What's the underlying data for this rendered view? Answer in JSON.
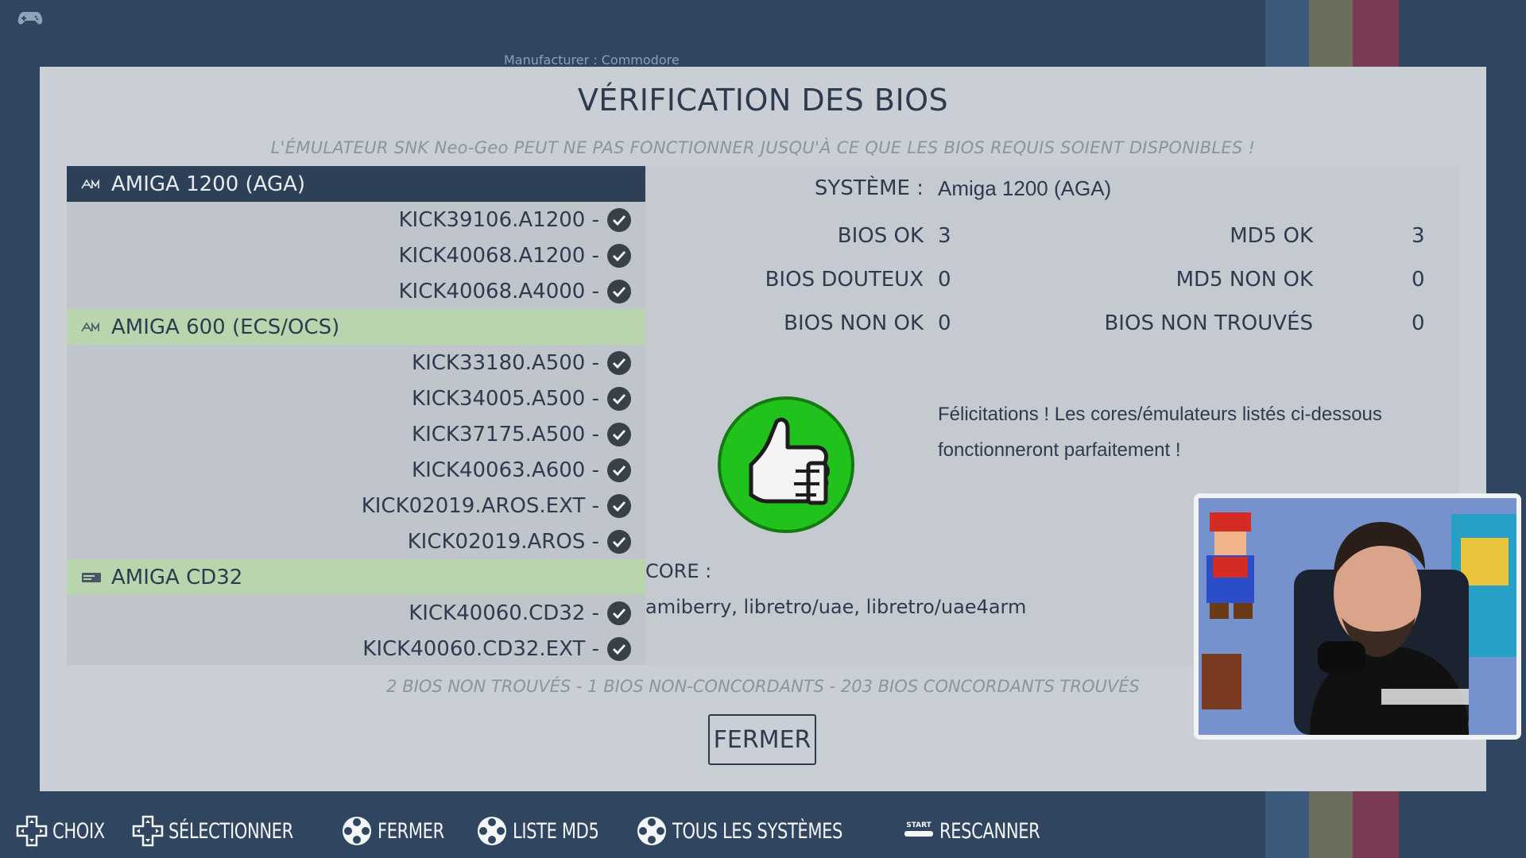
{
  "background": {
    "manufacturer_text": "Manufacturer : Commodore",
    "stripe_colors": [
      "#3c5a7c",
      "#6b6e5c",
      "#7a3c55"
    ]
  },
  "dialog": {
    "title": "VÉRIFICATION DES BIOS",
    "warning": "L'ÉMULATEUR SNK Neo-Geo PEUT NE PAS FONCTIONNER JUSQU'À CE QUE LES BIOS REQUIS SOIENT DISPONIBLES !",
    "summary": "2 BIOS NON TROUVÉS - 1 BIOS NON-CONCORDANTS - 203 BIOS CONCORDANTS TROUVÉS",
    "close_label": "FERMER"
  },
  "systems": [
    {
      "name": "AMIGA 1200 (AGA)",
      "state": "selected",
      "icon": "amiga-icon",
      "bios": [
        "KICK39106.A1200 -",
        "KICK40068.A1200 -",
        "KICK40068.A4000 -"
      ]
    },
    {
      "name": "AMIGA 600 (ECS/OCS)",
      "state": "group",
      "icon": "amiga-icon",
      "bios": [
        "KICK33180.A500 -",
        "KICK34005.A500 -",
        "KICK37175.A500 -",
        "KICK40063.A600 -",
        "KICK02019.AROS.EXT -",
        "KICK02019.AROS -"
      ]
    },
    {
      "name": "AMIGA CD32",
      "state": "group",
      "icon": "cd32-console-icon",
      "bios": [
        "KICK40060.CD32 -",
        "KICK40060.CD32.EXT -"
      ]
    }
  ],
  "detail": {
    "system_label": "SYSTÈME :",
    "system_value": "Amiga 1200 (AGA)",
    "bios_ok_label": "BIOS OK",
    "bios_ok_value": "3",
    "bios_douteux_label": "BIOS DOUTEUX",
    "bios_douteux_value": "0",
    "bios_non_ok_label": "BIOS NON OK",
    "bios_non_ok_value": "0",
    "md5_ok_label": "MD5 OK",
    "md5_ok_value": "3",
    "md5_non_ok_label": "MD5 NON OK",
    "md5_non_ok_value": "0",
    "bios_non_trouves_label": "BIOS NON TROUVÉS",
    "bios_non_trouves_value": "0",
    "congrats_line1": "Félicitations ! Les cores/émulateurs listés ci-dessous",
    "congrats_line2": "fonctionneront parfaitement !",
    "core_label": "CORE :",
    "core_value": "amiberry, libretro/uae, libretro/uae4arm",
    "status_icon": "thumbs-up-icon"
  },
  "help_bar": [
    {
      "icon": "dpad-icon",
      "label": "CHOIX"
    },
    {
      "icon": "dpad-icon",
      "label": "SÉLECTIONNER"
    },
    {
      "icon": "buttons-icon",
      "label": "FERMER"
    },
    {
      "icon": "buttons-icon",
      "label": "LISTE MD5"
    },
    {
      "icon": "buttons-icon",
      "label": "TOUS LES SYSTÈMES"
    },
    {
      "icon": "start-icon",
      "label": "RESCANNER",
      "icon_text": "START"
    }
  ]
}
